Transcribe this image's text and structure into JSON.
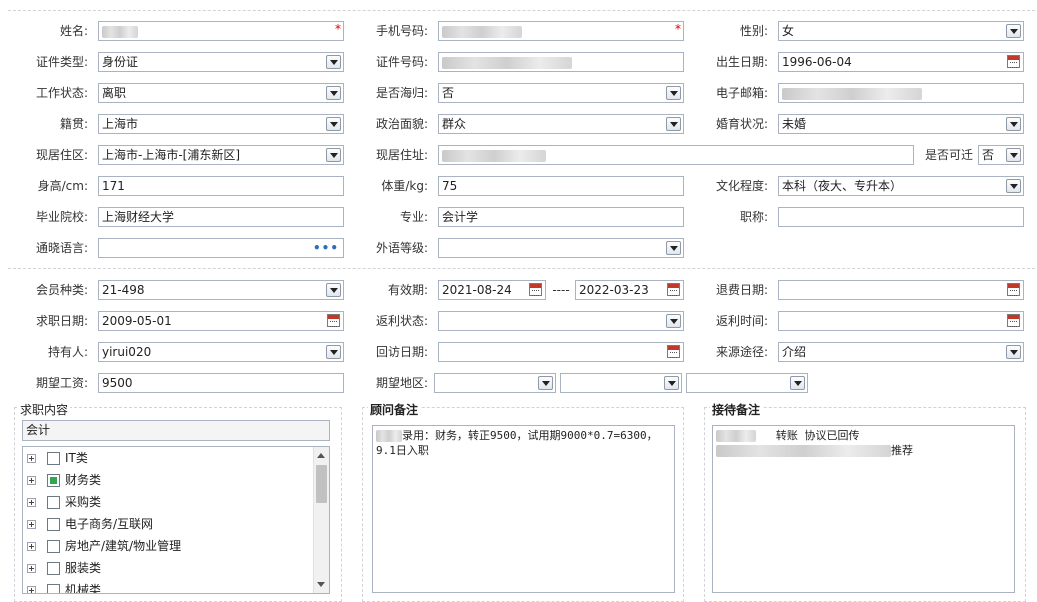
{
  "section1": {
    "name_label": "姓名:",
    "phone_label": "手机号码:",
    "gender_label": "性别:",
    "gender_value": "女",
    "idtype_label": "证件类型:",
    "idtype_value": "身份证",
    "idno_label": "证件号码:",
    "birth_label": "出生日期:",
    "birth_value": "1996-06-04",
    "workstatus_label": "工作状态:",
    "workstatus_value": "离职",
    "returnee_label": "是否海归:",
    "returnee_value": "否",
    "email_label": "电子邮箱:",
    "native_label": "籍贯:",
    "native_value": "上海市",
    "political_label": "政治面貌:",
    "political_value": "群众",
    "marital_label": "婚育状况:",
    "marital_value": "未婚",
    "residence_area_label": "现居住区:",
    "residence_area_value": "上海市-上海市-[浦东新区]",
    "residence_addr_label": "现居住址:",
    "relocate_label": "是否可迁",
    "relocate_value": "否",
    "height_label": "身高/cm:",
    "height_value": "171",
    "weight_label": "体重/kg:",
    "weight_value": "75",
    "education_label": "文化程度:",
    "education_value": "本科（夜大、专升本）",
    "school_label": "毕业院校:",
    "school_value": "上海财经大学",
    "major_label": "专业:",
    "major_value": "会计学",
    "title_label": "职称:",
    "language_label": "通晓语言:",
    "forlevel_label": "外语等级:"
  },
  "section2": {
    "member_label": "会员种类:",
    "member_value": "21-498",
    "valid_label": "有效期:",
    "valid_from": "2021-08-24",
    "valid_sep": "----",
    "valid_to": "2022-03-23",
    "refund_date_label": "退费日期:",
    "jobdate_label": "求职日期:",
    "jobdate_value": "2009-05-01",
    "rebate_status_label": "返利状态:",
    "rebate_time_label": "返利时间:",
    "holder_label": "持有人:",
    "holder_value": "yirui020",
    "visit_label": "回访日期:",
    "source_label": "来源途径:",
    "source_value": "介绍",
    "salary_label": "期望工资:",
    "salary_value": "9500",
    "region_label": "期望地区:"
  },
  "job": {
    "title": "求职内容",
    "selected": "会计",
    "items": [
      {
        "label": "IT类",
        "checked": false
      },
      {
        "label": "财务类",
        "checked": true
      },
      {
        "label": "采购类",
        "checked": false
      },
      {
        "label": "电子商务/互联网",
        "checked": false
      },
      {
        "label": "房地产/建筑/物业管理",
        "checked": false
      },
      {
        "label": "服装类",
        "checked": false
      },
      {
        "label": "机械类",
        "checked": false
      }
    ]
  },
  "consultant": {
    "title": "顾问备注",
    "note_line1": "录用：财务，转正9500，试用期9000*0.7=6300，",
    "note_line2": "9.1日入职"
  },
  "reception": {
    "title": "接待备注",
    "note_line1": "转账 协议已回传",
    "note_line2": "推荐"
  },
  "colors": {
    "border": "#a9b3c2",
    "required": "#d40000",
    "checked": "#2fa84f"
  }
}
